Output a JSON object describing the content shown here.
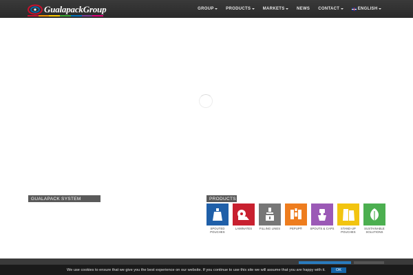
{
  "header": {
    "logo_text": "GualapackGroup",
    "logo_stripe_colors": [
      "#c8102e",
      "#f39200",
      "#ffcc00",
      "#3aaa35",
      "#0072bc",
      "#7d3c98",
      "#e4007c"
    ],
    "nav": [
      {
        "label": "GROUP",
        "dropdown": true
      },
      {
        "label": "PRODUCTS",
        "dropdown": true
      },
      {
        "label": "MARKETS",
        "dropdown": true
      },
      {
        "label": "NEWS",
        "dropdown": false
      },
      {
        "label": "CONTACT",
        "dropdown": true
      },
      {
        "label": "ENGLISH",
        "dropdown": true,
        "flag": "uk-flag-icon"
      }
    ]
  },
  "main": {
    "loading_spinner": "spinner-icon"
  },
  "sections": {
    "system_label": "GUALAPACK  SYSTEM",
    "products_label": "PRODUCTS"
  },
  "products": [
    {
      "label": "SPOUTED POUCHES",
      "color": "#1f5fa8",
      "icon": "spouted-pouch-icon"
    },
    {
      "label": "LAMINATES",
      "color": "#c8202f",
      "icon": "laminate-roll-icon"
    },
    {
      "label": "FILLING LINES",
      "color": "#777777",
      "icon": "filling-machine-icon"
    },
    {
      "label": "PEPUP®",
      "color": "#ee7d1e",
      "icon": "pepup-icon"
    },
    {
      "label": "SPOUTS & CAPS",
      "color": "#9b59b6",
      "icon": "spout-cap-icon"
    },
    {
      "label": "STAND-UP POUCHES",
      "color": "#f2c40f",
      "icon": "standup-pouch-icon"
    },
    {
      "label": "SUSTAINABLE SOLUTIONS",
      "color": "#4caf50",
      "icon": "leaf-icon"
    }
  ],
  "cookie": {
    "text": "We use cookies to ensure that we give you the best experience on our website. If you continue to use this site we will assume that you are happy with it.",
    "ok_label": "OK"
  }
}
